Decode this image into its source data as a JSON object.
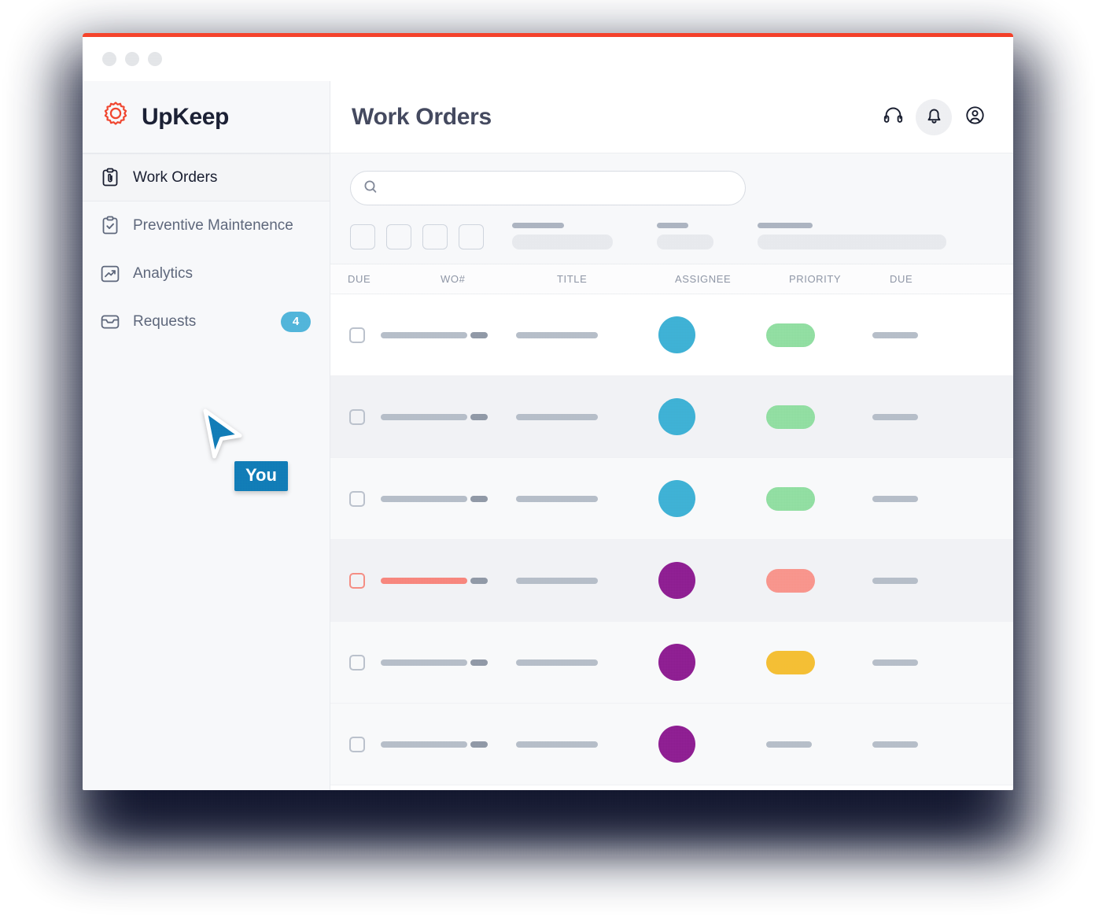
{
  "window": {
    "accent_color": "#f4412b",
    "traffic_dots": [
      "dot-close",
      "dot-minimize",
      "dot-maximize"
    ]
  },
  "sidebar": {
    "logo": {
      "name": "UpKeep",
      "icon": "gear-icon",
      "color": "#f0442e"
    },
    "items": [
      {
        "label": "Work Orders",
        "icon": "clipboard-attachment-icon",
        "active": true,
        "badge": ""
      },
      {
        "label": "Preventive Maintenence",
        "icon": "clipboard-check-icon",
        "active": false,
        "badge": ""
      },
      {
        "label": "Analytics",
        "icon": "chart-trend-icon",
        "active": false,
        "badge": ""
      },
      {
        "label": "Requests",
        "icon": "inbox-icon",
        "active": false,
        "badge": "4"
      }
    ],
    "badge_color": "#4fb3d9"
  },
  "cursor": {
    "label": "You",
    "color": "#1179b5",
    "icon": "cursor-arrow-icon"
  },
  "header": {
    "title": "Work Orders",
    "icons": [
      {
        "name": "headset-icon",
        "highlighted": false
      },
      {
        "name": "bell-icon",
        "highlighted": true
      },
      {
        "name": "account-circle-icon",
        "highlighted": false
      }
    ]
  },
  "search": {
    "value": "",
    "placeholder": "",
    "icon": "search-icon"
  },
  "filters": {
    "square_buttons": [
      "filter-button-1",
      "filter-button-2",
      "filter-button-3",
      "filter-button-4"
    ],
    "skeleton_groups": [
      {
        "top_width": 66,
        "bottom_width": 128
      },
      {
        "top_width": 40,
        "bottom_width": 72
      },
      {
        "top_width": 70,
        "bottom_width": 240
      }
    ]
  },
  "table": {
    "columns": [
      "DUE",
      "WO#",
      "TITLE",
      "ASSIGNEE",
      "PRIORITY",
      "DUE"
    ],
    "rows": [
      {
        "checkbox": "normal",
        "wo_bar": "normal",
        "title_bar": "normal",
        "avatar": "#3dafd4",
        "priority": "#8edd9f",
        "due_bar": "normal",
        "stripe": "white"
      },
      {
        "checkbox": "normal",
        "wo_bar": "normal",
        "title_bar": "normal",
        "avatar": "#3dafd4",
        "priority": "#8edd9f",
        "due_bar": "normal",
        "stripe": "dark"
      },
      {
        "checkbox": "normal",
        "wo_bar": "normal",
        "title_bar": "normal",
        "avatar": "#3dafd4",
        "priority": "#8edd9f",
        "due_bar": "normal",
        "stripe": "light"
      },
      {
        "checkbox": "alert",
        "wo_bar": "alert",
        "title_bar": "normal",
        "avatar": "#8b1e8f",
        "priority": "#f89289",
        "due_bar": "normal",
        "stripe": "dark"
      },
      {
        "checkbox": "normal",
        "wo_bar": "normal",
        "title_bar": "normal",
        "avatar": "#8b1e8f",
        "priority": "#f4bd33",
        "due_bar": "normal",
        "stripe": "light"
      },
      {
        "checkbox": "normal",
        "wo_bar": "normal",
        "title_bar": "normal",
        "avatar": "#8b1e8f",
        "priority": "bar",
        "due_bar": "normal",
        "stripe": "light"
      }
    ]
  },
  "colors": {
    "accent_red": "#f4412b",
    "avatar_blue": "#3dafd4",
    "avatar_purple": "#8b1e8f",
    "priority_green": "#8edd9f",
    "priority_salmon": "#f89289",
    "priority_amber": "#f4bd33",
    "badge_blue": "#4fb3d9",
    "cursor_blue": "#1179b5"
  }
}
